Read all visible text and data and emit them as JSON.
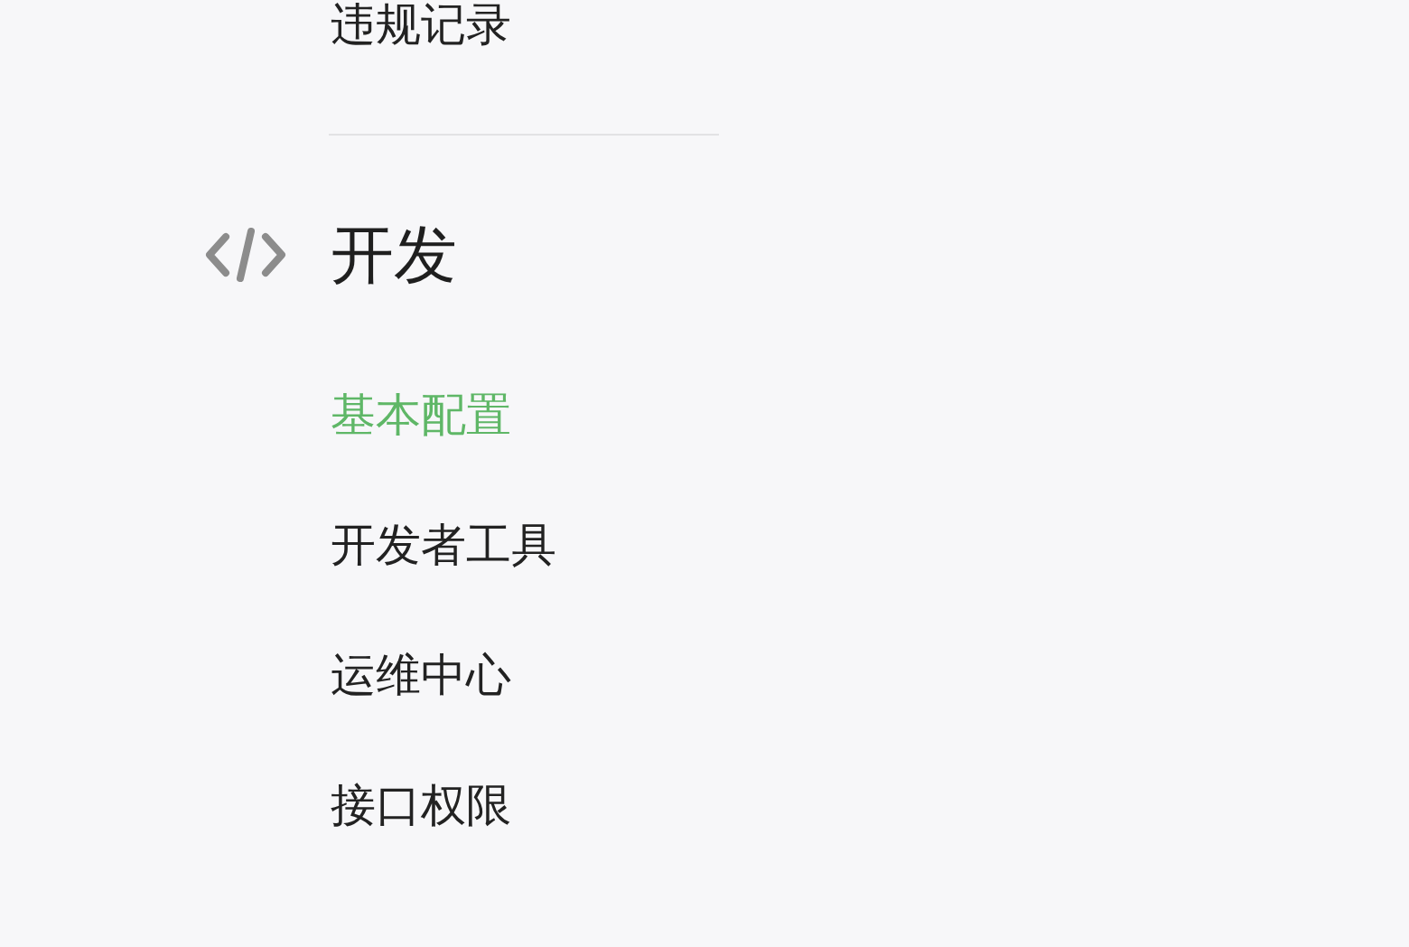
{
  "menu_groups": [
    {
      "items": [
        {
          "label": "违规记录",
          "selected": false
        }
      ]
    },
    {
      "title": "开发",
      "items": [
        {
          "label": "基本配置",
          "selected": true
        },
        {
          "label": "开发者工具",
          "selected": false
        },
        {
          "label": "运维中心",
          "selected": false
        },
        {
          "label": "接口权限",
          "selected": false
        }
      ]
    }
  ]
}
